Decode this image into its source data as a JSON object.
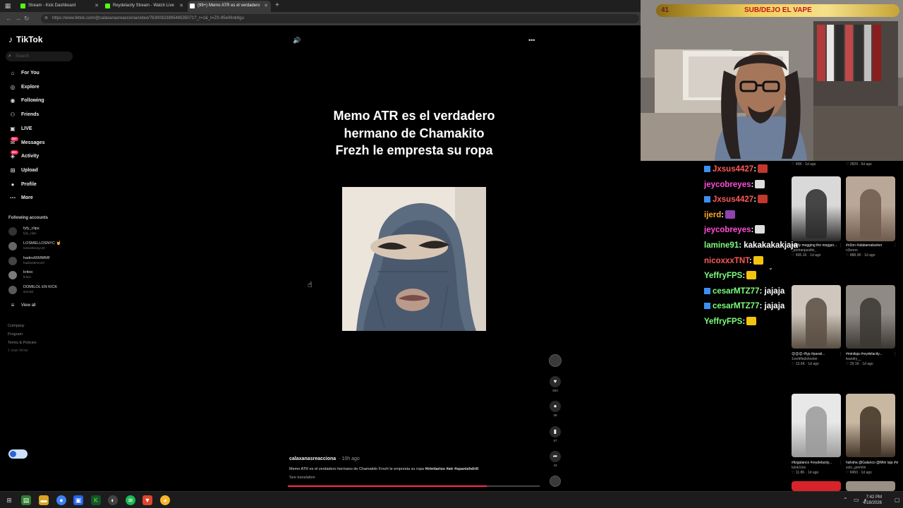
{
  "browser": {
    "tabs": [
      {
        "label": "Stream - Kick Dashboard",
        "fav_color": "#53fc18",
        "active": false
      },
      {
        "label": "Reydelacity Stream - Watch Live",
        "fav_color": "#53fc18",
        "active": false
      },
      {
        "label": "(99+) Memo ATR es el verdadero",
        "fav_color": "#ffffff",
        "active": true
      }
    ],
    "url": "https://www.tiktok.com/@calaxanasreacciona/video/7630082389548535071?_r=1&_t=ZS-95e06nk9gu"
  },
  "tiktok": {
    "logo": "TikTok",
    "search_placeholder": "Search",
    "nav": [
      {
        "label": "For You",
        "icon": "home-icon",
        "glyph": "⌂"
      },
      {
        "label": "Explore",
        "icon": "compass-icon",
        "glyph": "◎"
      },
      {
        "label": "Following",
        "icon": "following-icon",
        "glyph": "◉"
      },
      {
        "label": "Friends",
        "icon": "friends-icon",
        "glyph": "⚇"
      },
      {
        "label": "LIVE",
        "icon": "live-icon",
        "glyph": "▣"
      },
      {
        "label": "Messages",
        "icon": "messages-icon",
        "glyph": "✉",
        "badge": "99+"
      },
      {
        "label": "Activity",
        "icon": "activity-icon",
        "glyph": "◈",
        "badge": "99+"
      },
      {
        "label": "Upload",
        "icon": "upload-icon",
        "glyph": "⊞"
      },
      {
        "label": "Profile",
        "icon": "profile-icon",
        "glyph": "●"
      },
      {
        "label": "More",
        "icon": "more-icon",
        "glyph": "⋯"
      }
    ],
    "following_title": "Following accounts",
    "following": [
      {
        "name": "fyfy_clips",
        "handle": "fyfy_clips"
      },
      {
        "name": "LOSMELLOSNYC 🤘",
        "handle": "losmellosnyc22"
      },
      {
        "name": "hades66MMMF",
        "handle": "hades66mmmf"
      },
      {
        "name": "kritoo",
        "handle": "kritoo"
      },
      {
        "name": "DOMILOL EN KICK",
        "handle": "domilol"
      }
    ],
    "view_all": "View all",
    "footer": [
      "Company",
      "Program",
      "Terms & Policies",
      "© 2026 TikTok"
    ]
  },
  "video": {
    "headline": "Memo ATR es el verdadero hermano de Chamakito Frezh le empresta su ropa",
    "actions": [
      {
        "icon": "heart-icon",
        "glyph": "♥",
        "count": "553"
      },
      {
        "icon": "comment-icon",
        "glyph": "●",
        "count": "28"
      },
      {
        "icon": "bookmark-icon",
        "glyph": "▮",
        "count": "57"
      },
      {
        "icon": "share-icon",
        "glyph": "➦",
        "count": "43"
      }
    ],
    "username": "calaxanasreacciona",
    "age": "· 10h ago",
    "caption_text": "Memo ATR es el verdadero hermano de Chamakito Frezh le empresta su ropa",
    "caption_tags": "#trinitarios #atr #spanishdrill",
    "see_translation": "See translation",
    "progress": 0.79
  },
  "webcam": {
    "count": "41",
    "message": "SUB/DEJO EL VAPE"
  },
  "chat": [
    {
      "user": "Jxsus4427",
      "color": "#ff5a5a",
      "msg": ":",
      "badges": true,
      "emote_color": "#c0392b"
    },
    {
      "user": "jeycobreyes",
      "color": "#ff4fd8",
      "msg": ":",
      "badges": false,
      "emote_color": "#dddddd"
    },
    {
      "user": "Jxsus4427",
      "color": "#ff5a5a",
      "msg": ":",
      "badges": true,
      "emote_color": "#c0392b"
    },
    {
      "user": "ijerd",
      "color": "#ffa726",
      "msg": ":",
      "badges": false,
      "emote_color": "#8e44ad"
    },
    {
      "user": "jeycobreyes",
      "color": "#ff4fd8",
      "msg": ":",
      "badges": false,
      "emote_color": "#dddddd"
    },
    {
      "user": "lamine91",
      "color": "#7cff7c",
      "msg": ": kakakakakjaja",
      "badges": false,
      "emote_color": ""
    },
    {
      "user": "nicoxxxTNT",
      "color": "#ff5a5a",
      "msg": ":",
      "badges": false,
      "emote_color": "#f1c40f"
    },
    {
      "user": "YeffryFPS",
      "color": "#7cff7c",
      "msg": ":",
      "badges": false,
      "emote_color": "#f1c40f"
    },
    {
      "user": "cesarMTZ77",
      "color": "#7cff7c",
      "msg": ": jajaja",
      "badges": true,
      "emote_color": ""
    },
    {
      "user": "cesarMTZ77",
      "color": "#7cff7c",
      "msg": ": jajaja",
      "badges": true,
      "emote_color": ""
    },
    {
      "user": "YeffryFPS",
      "color": "#7cff7c",
      "msg": ":",
      "badges": false,
      "emote_color": "#f1c40f"
    }
  ],
  "grid": {
    "top_stats": [
      {
        "stat": "♡ 40K · 1d ago"
      },
      {
        "stat": "♡ 2829 · 5d ago"
      }
    ],
    "items": [
      {
        "title": "totally mogging the mogger...",
        "by": "_pontanjaeditz_",
        "stat": "♡ 406.1K · 1d ago",
        "c1": "#d9d9d9",
        "c2": "#2a2a2a"
      },
      {
        "title": "#n3on #alabamabarker",
        "by": "n3onnn",
        "stat": "♡ 888.3K · 1d ago",
        "c1": "#b9a797",
        "c2": "#6e5a4c"
      },
      {
        "title": "😊😊😊 #fyp #parati...",
        "by": "1certifiedshooter",
        "stat": "♡ 13.6K · 1d ago",
        "c1": "#cfc7bd",
        "c2": "#5a4e42"
      },
      {
        "title": "#minilaja #reydelacity...",
        "by": "leandry__",
        "stat": "♡ 29.1K · 1d ago",
        "c1": "#8f8a83",
        "c2": "#3b3733"
      },
      {
        "title": "#itzgalanco #reydelacity...",
        "by": "tulok1too",
        "stat": "♡ 11.8K · 1d ago",
        "c1": "#e8e8e8",
        "c2": "#9a9a9a"
      },
      {
        "title": "hahaha @Galanco @Mini laja #viral...",
        "by": "solo_gremlin",
        "stat": "♡ 8450 · 1d ago",
        "c1": "#c8b8a2",
        "c2": "#403226"
      }
    ]
  },
  "taskbar": {
    "time": "7:42 PM",
    "date": "4/18/2026"
  }
}
